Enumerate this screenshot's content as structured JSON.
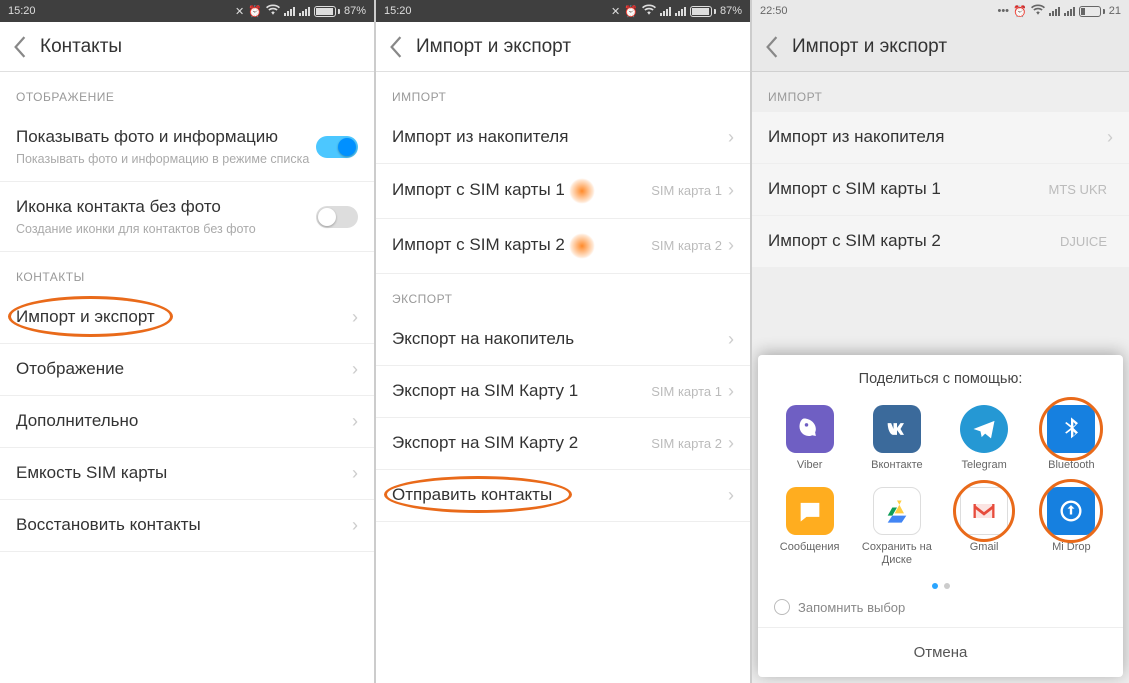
{
  "screen1": {
    "time": "15:20",
    "battery": "87%",
    "title": "Контакты",
    "section_display": "ОТОБРАЖЕНИЕ",
    "show_photo": {
      "title": "Показывать фото и информацию",
      "sub": "Показывать фото и информацию в режиме списка"
    },
    "icon_no_photo": {
      "title": "Иконка контакта без фото",
      "sub": "Создание иконки для контактов без фото"
    },
    "section_contacts": "КОНТАКТЫ",
    "items": {
      "import_export": "Импорт и экспорт",
      "display": "Отображение",
      "advanced": "Дополнительно",
      "sim_capacity": "Емкость SIM карты",
      "restore": "Восстановить контакты"
    }
  },
  "screen2": {
    "time": "15:20",
    "battery": "87%",
    "title": "Импорт и экспорт",
    "section_import": "ИМПОРТ",
    "import_storage": "Импорт из накопителя",
    "import_sim1": "Импорт с SIM карты 1",
    "import_sim1_val": "SIM карта 1",
    "import_sim2": "Импорт с SIM карты 2",
    "import_sim2_val": "SIM карта 2",
    "section_export": "ЭКСПОРТ",
    "export_storage": "Экспорт на накопитель",
    "export_sim1": "Экспорт на SIM Карту 1",
    "export_sim1_val": "SIM карта 1",
    "export_sim2": "Экспорт на SIM Карту 2",
    "export_sim2_val": "SIM карта 2",
    "send_contacts": "Отправить контакты"
  },
  "screen3": {
    "time": "22:50",
    "battery": "21",
    "title": "Импорт и экспорт",
    "section_import": "ИМПОРТ",
    "import_storage": "Импорт из накопителя",
    "import_sim1": "Импорт с SIM карты 1",
    "import_sim1_val": "MTS UKR",
    "import_sim2": "Импорт с SIM карты 2",
    "import_sim2_val": "DJUICE",
    "sheet_title": "Поделиться с помощью:",
    "apps": {
      "viber": "Viber",
      "vk": "Вконтакте",
      "telegram": "Telegram",
      "bluetooth": "Bluetooth",
      "messages": "Сообщения",
      "drive": "Сохранить на Диске",
      "gmail": "Gmail",
      "midrop": "Mi Drop"
    },
    "remember": "Запомнить выбор",
    "cancel": "Отмена"
  }
}
